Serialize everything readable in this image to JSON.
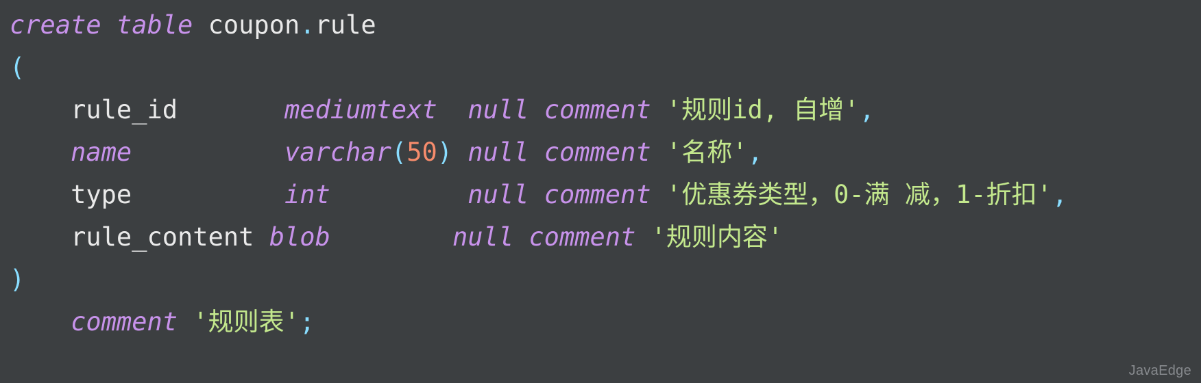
{
  "editor": {
    "background_color": "#3c3f41",
    "colors": {
      "keyword": "#c792ea",
      "identifier": "#e9e9e9",
      "punctuation": "#89ddff",
      "string": "#c3e88d",
      "number": "#f78c6c",
      "watermark": "#8b8e92"
    }
  },
  "code": {
    "language": "sql",
    "full_text": "create table coupon.rule\n(\n    rule_id       mediumtext  null comment '规则id, 自增',\n    name          varchar(50) null comment '名称',\n    type          int         null comment '优惠券类型，0-满 减，1-折扣',\n    rule_content  blob        null comment '规则内容'\n)\n    comment '规则表';",
    "lines": [
      {
        "index": 1,
        "tokens": [
          {
            "t": "create",
            "k": "kw"
          },
          {
            "t": " ",
            "k": "plain"
          },
          {
            "t": "table",
            "k": "kw"
          },
          {
            "t": " ",
            "k": "plain"
          },
          {
            "t": "coupon",
            "k": "ident"
          },
          {
            "t": ".",
            "k": "punc"
          },
          {
            "t": "rule",
            "k": "ident"
          }
        ]
      },
      {
        "index": 2,
        "tokens": [
          {
            "t": "(",
            "k": "punc"
          }
        ]
      },
      {
        "index": 3,
        "tokens": [
          {
            "t": "    rule_id      ",
            "k": "ident"
          },
          {
            "t": " mediumtext",
            "k": "kw"
          },
          {
            "t": "  ",
            "k": "plain"
          },
          {
            "t": "null comment",
            "k": "kw"
          },
          {
            "t": " ",
            "k": "plain"
          },
          {
            "t": "'规则id, 自增'",
            "k": "str"
          },
          {
            "t": ",",
            "k": "punc"
          }
        ]
      },
      {
        "index": 4,
        "tokens": [
          {
            "t": "    ",
            "k": "plain"
          },
          {
            "t": "name",
            "k": "kw"
          },
          {
            "t": "          ",
            "k": "plain"
          },
          {
            "t": "varchar",
            "k": "kw"
          },
          {
            "t": "(",
            "k": "punc"
          },
          {
            "t": "50",
            "k": "num"
          },
          {
            "t": ")",
            "k": "punc"
          },
          {
            "t": " ",
            "k": "plain"
          },
          {
            "t": "null comment",
            "k": "kw"
          },
          {
            "t": " ",
            "k": "plain"
          },
          {
            "t": "'名称'",
            "k": "str"
          },
          {
            "t": ",",
            "k": "punc"
          }
        ]
      },
      {
        "index": 5,
        "tokens": [
          {
            "t": "    type         ",
            "k": "ident"
          },
          {
            "t": " int",
            "k": "kw"
          },
          {
            "t": "         ",
            "k": "plain"
          },
          {
            "t": "null comment",
            "k": "kw"
          },
          {
            "t": " ",
            "k": "plain"
          },
          {
            "t": "'优惠券类型，0-满 减，1-折扣'",
            "k": "str"
          },
          {
            "t": ",",
            "k": "punc"
          }
        ]
      },
      {
        "index": 6,
        "tokens": [
          {
            "t": "    rule_content",
            "k": "ident"
          },
          {
            "t": " blob",
            "k": "kw"
          },
          {
            "t": "        ",
            "k": "plain"
          },
          {
            "t": "null comment",
            "k": "kw"
          },
          {
            "t": " ",
            "k": "plain"
          },
          {
            "t": "'规则内容'",
            "k": "str"
          }
        ]
      },
      {
        "index": 7,
        "tokens": [
          {
            "t": ")",
            "k": "punc"
          }
        ]
      },
      {
        "index": 8,
        "tokens": [
          {
            "t": "    ",
            "k": "plain"
          },
          {
            "t": "comment",
            "k": "kw"
          },
          {
            "t": " ",
            "k": "plain"
          },
          {
            "t": "'规则表'",
            "k": "str"
          },
          {
            "t": ";",
            "k": "punc"
          }
        ]
      }
    ]
  },
  "watermark": {
    "label": "JavaEdge"
  }
}
